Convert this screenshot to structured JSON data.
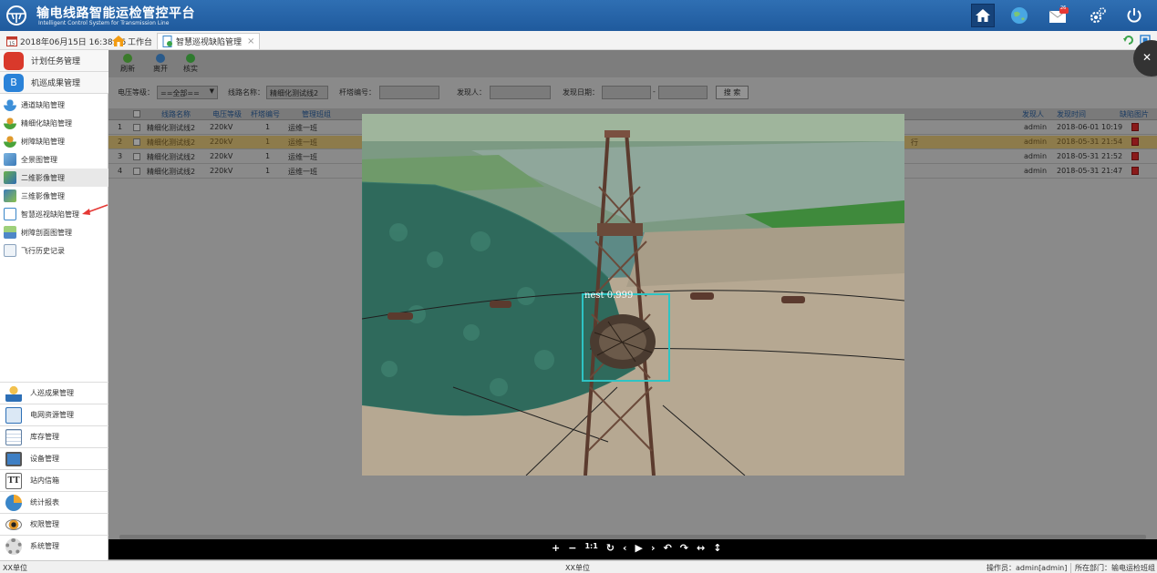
{
  "app": {
    "title": "输电线路智能运检管控平台",
    "subtitle": "Intelligent Control System for Transmission Line",
    "mail_badge": "26",
    "icons": [
      "home-icon",
      "globe-icon",
      "mail-icon",
      "settings-icon",
      "power-icon"
    ]
  },
  "tabbar": {
    "datetime": "2018年06月15日 16:38:26",
    "tabs": [
      {
        "label": "工作台",
        "icon": "home-icon"
      },
      {
        "label": "智慧巡视缺陷管理",
        "icon": "document-icon",
        "active": true,
        "closable": true
      }
    ]
  },
  "sidebar": {
    "groups": [
      {
        "label": "计划任务管理",
        "icon": "stop-sign-icon"
      },
      {
        "label": "机巡成果管理",
        "icon": "app-b-icon"
      }
    ],
    "items": [
      {
        "label": "通道缺陷管理",
        "icon": "user-icon"
      },
      {
        "label": "精细化缺陷管理",
        "icon": "user-icon"
      },
      {
        "label": "树障缺陷管理",
        "icon": "user-icon"
      },
      {
        "label": "全景图管理",
        "icon": "image-icon"
      },
      {
        "label": "二维影像管理",
        "icon": "image-icon",
        "selected": true
      },
      {
        "label": "三维影像管理",
        "icon": "image-icon"
      },
      {
        "label": "智慧巡视缺陷管理",
        "icon": "document-icon"
      },
      {
        "label": "树障剖面图管理",
        "icon": "chart-icon"
      },
      {
        "label": "飞行历史记录",
        "icon": "picture-icon"
      }
    ],
    "bottom": [
      {
        "label": "人巡成果管理",
        "icon": "worker-icon"
      },
      {
        "label": "电网资源管理",
        "icon": "network-icon"
      },
      {
        "label": "库存管理",
        "icon": "calendar-icon"
      },
      {
        "label": "设备管理",
        "icon": "monitor-icon"
      },
      {
        "label": "站内信箱",
        "icon": "tt-icon"
      },
      {
        "label": "统计报表",
        "icon": "pie-chart-icon"
      },
      {
        "label": "权限管理",
        "icon": "eye-icon"
      },
      {
        "label": "系统管理",
        "icon": "gear-icon"
      }
    ]
  },
  "toolbar": {
    "buttons": [
      {
        "label": "刷新",
        "icon": "refresh-icon"
      },
      {
        "label": "离开",
        "icon": "leave-icon"
      },
      {
        "label": "核实",
        "icon": "verify-icon"
      }
    ]
  },
  "filters": {
    "voltage_label": "电压等级：",
    "voltage_value": "==全部==",
    "line_label": "线路名称：",
    "line_value": "精细化测试线2",
    "tower_label": "杆塔编号：",
    "finder_label": "发现人：",
    "date_label": "发现日期：",
    "date_sep": "-",
    "search": "搜 索"
  },
  "table": {
    "columns": [
      "线路名称",
      "电压等级",
      "杆塔编号",
      "管理班组",
      "发现人",
      "发现时间",
      "缺陷图片"
    ],
    "rows": [
      {
        "no": "1",
        "line": "精细化测试线2",
        "voltage": "220kV",
        "tower": "1",
        "team": "运维一班",
        "finder": "admin",
        "time": "2018-06-01 10:19"
      },
      {
        "no": "2",
        "line": "精细化测试线2",
        "voltage": "220kV",
        "tower": "1",
        "team": "运维一班",
        "finder": "admin",
        "time": "2018-05-31 21:54"
      },
      {
        "no": "3",
        "line": "精细化测试线2",
        "voltage": "220kV",
        "tower": "1",
        "team": "运维一班",
        "finder": "admin",
        "time": "2018-05-31 21:52"
      },
      {
        "no": "4",
        "line": "精细化测试线2",
        "voltage": "220kV",
        "tower": "1",
        "team": "运维一班",
        "finder": "admin",
        "time": "2018-05-31 21:47"
      }
    ],
    "row2_extra": "行"
  },
  "photo": {
    "detection_label": "nest 0.999"
  },
  "viewer": {
    "controls": [
      "+",
      "−",
      "1:1",
      "↻",
      "‹",
      "▶",
      "›",
      "↶",
      "↷",
      "↔",
      "↕"
    ]
  },
  "status": {
    "left": "XX单位",
    "center": "XX单位",
    "operator": "操作员：admin[admin]",
    "dept": "所在部门：输电运检班组"
  },
  "colors": {
    "header": "#1f5a9d",
    "annotation_arrow": "#e53935",
    "detection_box": "#2ec4c4"
  }
}
